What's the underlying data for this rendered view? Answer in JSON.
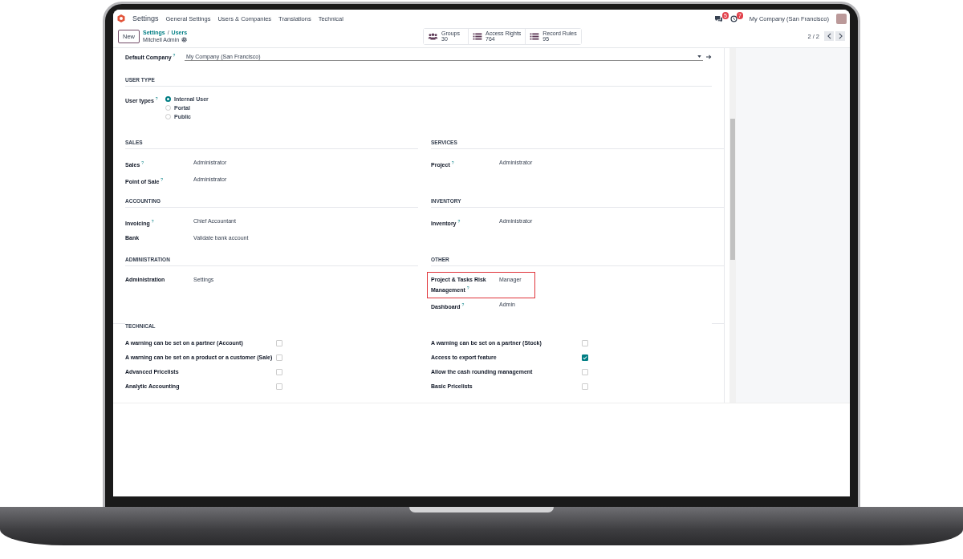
{
  "navbar": {
    "app_name": "Settings",
    "menus": [
      "General Settings",
      "Users & Companies",
      "Translations",
      "Technical"
    ],
    "messages_badge": "5",
    "activities_badge": "7",
    "company": "My Company (San Francisco)"
  },
  "control_panel": {
    "new_button": "New",
    "breadcrumbs": [
      "Settings",
      "Users"
    ],
    "breadcrumb_separator": "/",
    "record_title": "Mitchell Admin",
    "smart_buttons": [
      {
        "kind": "groups",
        "label": "Groups",
        "value": "30"
      },
      {
        "kind": "list",
        "label": "Access Rights",
        "value": "764"
      },
      {
        "kind": "list",
        "label": "Record Rules",
        "value": "95"
      }
    ],
    "pager": "2 / 2"
  },
  "form": {
    "default_company": {
      "label": "Default Company",
      "help": "?",
      "value": "My Company (San Francisco)"
    },
    "user_type": {
      "title": "USER TYPE",
      "label": "User types",
      "help": "?",
      "options": [
        {
          "label": "Internal User",
          "selected": true
        },
        {
          "label": "Portal",
          "selected": false
        },
        {
          "label": "Public",
          "selected": false
        }
      ]
    },
    "sections": [
      {
        "title": "SALES",
        "fields": [
          {
            "label": "Sales",
            "help": "?",
            "value": "Administrator",
            "highlighted": false
          },
          {
            "label": "Point of Sale",
            "help": "?",
            "value": "Administrator",
            "highlighted": false
          }
        ]
      },
      {
        "title": "SERVICES",
        "fields": [
          {
            "label": "Project",
            "help": "?",
            "value": "Administrator",
            "highlighted": false
          }
        ]
      },
      {
        "title": "ACCOUNTING",
        "fields": [
          {
            "label": "Invoicing",
            "help": "?",
            "value": "Chief Accountant",
            "highlighted": false
          },
          {
            "label": "Bank",
            "value": "Validate bank account",
            "highlighted": false
          }
        ]
      },
      {
        "title": "INVENTORY",
        "fields": [
          {
            "label": "Inventory",
            "help": "?",
            "value": "Administrator",
            "highlighted": false
          }
        ]
      },
      {
        "title": "ADMINISTRATION",
        "fields": [
          {
            "label": "Administration",
            "value": "Settings",
            "highlighted": false
          }
        ]
      },
      {
        "title": "OTHER",
        "fields": [
          {
            "label": "Project & Tasks Risk Management",
            "help": "?",
            "value": "Manager",
            "highlighted": true
          },
          {
            "label": "Dashboard",
            "help": "?",
            "value": "Admin",
            "highlighted": false
          }
        ]
      }
    ],
    "technical": {
      "title": "TECHNICAL",
      "options": [
        {
          "label": "A warning can be set on a partner (Account)",
          "checked": false
        },
        {
          "label": "A warning can be set on a partner (Stock)",
          "checked": false
        },
        {
          "label": "A warning can be set on a product or a customer (Sale)",
          "checked": false
        },
        {
          "label": "Access to export feature",
          "checked": true
        },
        {
          "label": "Advanced Pricelists",
          "checked": false
        },
        {
          "label": "Allow the cash rounding management",
          "checked": false
        },
        {
          "label": "Analytic Accounting",
          "checked": false
        },
        {
          "label": "Basic Pricelists",
          "checked": false
        }
      ]
    }
  }
}
